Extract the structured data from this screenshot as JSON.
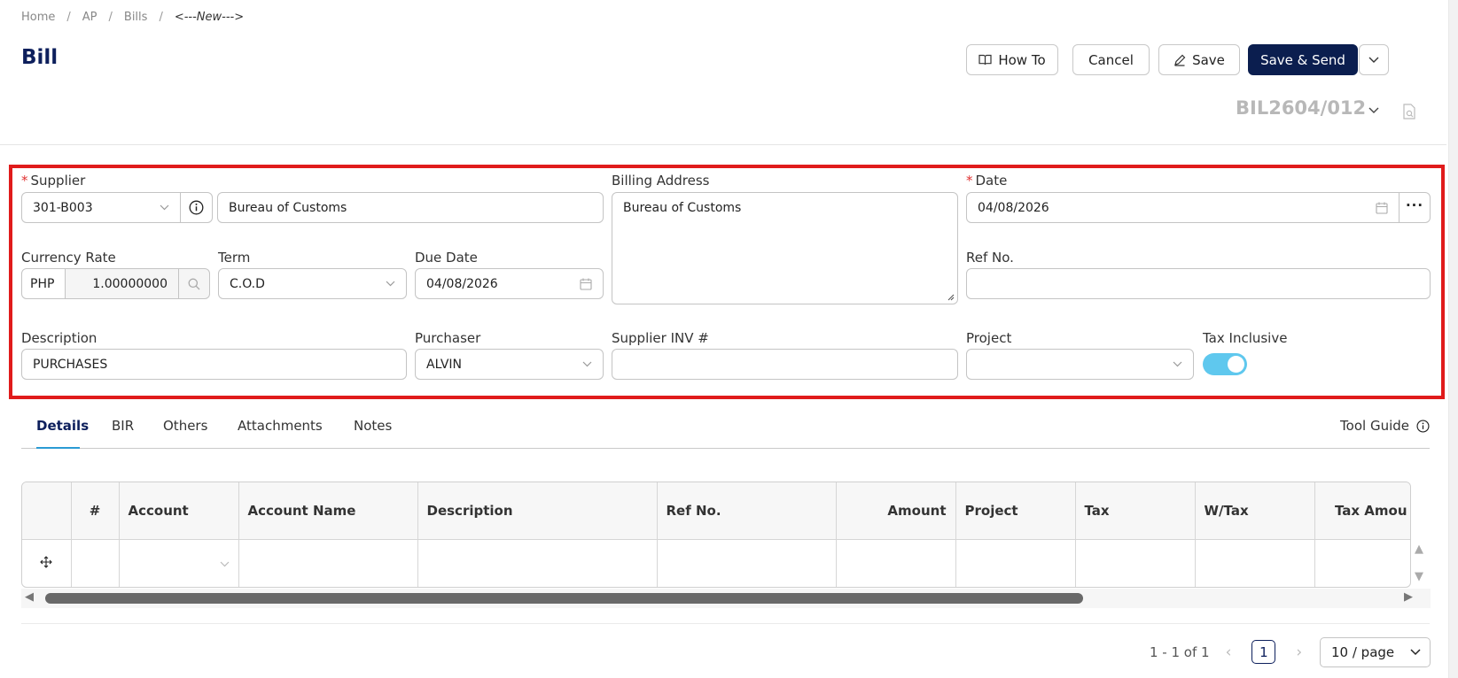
{
  "breadcrumb": [
    "Home",
    "AP",
    "Bills",
    "<---New--->"
  ],
  "page_title": "Bill",
  "toolbar": {
    "howto_label": "How To",
    "cancel_label": "Cancel",
    "save_label": "Save",
    "save_send_label": "Save & Send"
  },
  "document_number": "BIL2604/012",
  "form": {
    "supplier_label": "Supplier",
    "supplier_code": "301-B003",
    "supplier_name": "Bureau of Customs",
    "billing_address_label": "Billing Address",
    "billing_address": "Bureau of Customs",
    "date_label": "Date",
    "date": "04/08/2026",
    "currency_rate_label": "Currency Rate",
    "currency": "PHP",
    "rate": "1.00000000",
    "term_label": "Term",
    "term": "C.O.D",
    "due_date_label": "Due Date",
    "due_date": "04/08/2026",
    "ref_no_label": "Ref No.",
    "ref_no": "",
    "description_label": "Description",
    "description": "PURCHASES",
    "purchaser_label": "Purchaser",
    "purchaser": "ALVIN",
    "supplier_inv_label": "Supplier INV #",
    "supplier_inv": "",
    "project_label": "Project",
    "project": "",
    "tax_inclusive_label": "Tax Inclusive",
    "tax_inclusive": true
  },
  "tabs": [
    "Details",
    "BIR",
    "Others",
    "Attachments",
    "Notes"
  ],
  "tool_guide_label": "Tool Guide",
  "grid": {
    "columns": [
      "#",
      "Account",
      "Account Name",
      "Description",
      "Ref No.",
      "Amount",
      "Project",
      "Tax",
      "W/Tax",
      "Tax Amou"
    ]
  },
  "pagination": {
    "range_text": "1 - 1 of 1",
    "current_page": "1",
    "page_size": "10 / page"
  },
  "colors": {
    "primary": "#0b1e4f",
    "highlight_frame": "#e01b1b",
    "toggle_on": "#5fc8ee",
    "tab_accent": "#2a9bd4"
  }
}
